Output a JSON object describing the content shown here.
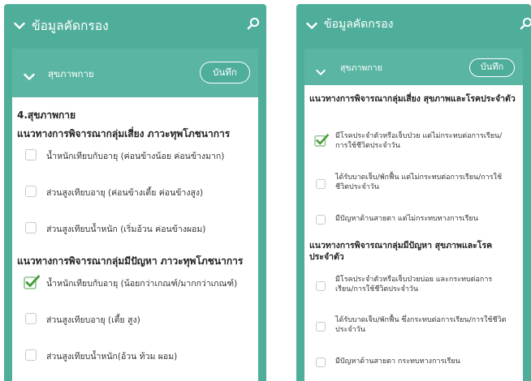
{
  "colors": {
    "accent": "#4fae9a",
    "header": "#5ab5a2",
    "check": "#4a9e3c"
  },
  "left": {
    "title": "ข้อมูลคัดกรอง",
    "card_label": "สุขภาพกาย",
    "save_label": "บันทึก",
    "heading": "4.สุขภาพกาย",
    "section1": "แนวทางการพิจารณากลุ่มเสี่ยง ภาวะทุพโภชนาการ",
    "items1": [
      {
        "label": "น้ำหนักเทียบกับอายุ (ค่อนข้างน้อย ค่อนข้างมาก)",
        "checked": false
      },
      {
        "label": "ส่วนสูงเทียบอายุ (ค่อนข้างเตี้ย ค่อนข้างสูง)",
        "checked": false
      },
      {
        "label": "ส่วนสูงเทียบน้ำหนัก (เริ่มอ้วน ค่อนข้างผอม)",
        "checked": false
      }
    ],
    "section2": "แนวทางการพิจารณากลุ่มมีปัญหา ภาวะทุพโภชนาการ",
    "items2": [
      {
        "label": "น้ำหนักเทียบกับอายุ (น้อยกว่าเกณฑ์/มากกว่าเกณฑ์)",
        "checked": true
      },
      {
        "label": "ส่วนสูงเทียบอายุ (เตี้ย สูง)",
        "checked": false
      },
      {
        "label": "ส่วนสูงเทียบน้ำหนัก(อ้วน ท้วม ผอม)",
        "checked": false
      }
    ]
  },
  "right": {
    "title": "ข้อมูลคัดกรอง",
    "card_label": "สุขภาพกาย",
    "save_label": "บันทึก",
    "section1": "แนวทางการพิจารณากลุ่มเสี่ยง สุขภาพและโรคประจำตัว",
    "items1": [
      {
        "label": "มีโรคประจำตัวหรือเจ็บป่วย แต่ไม่กระทบต่อการเรียน/การใช้ชีวิตประจำวัน",
        "checked": true
      },
      {
        "label": "ได้รับบาดเจ็บ/พักฟื้น แต่ไม่กระทบต่อการเรียน/การใช้ชีวิตประจำวัน",
        "checked": false
      },
      {
        "label": "มีปัญหาด้านสายตา แต่ไม่กระทบทางการเรียน",
        "checked": false
      }
    ],
    "section2": "แนวทางการพิจารณากลุ่มมีปัญหา สุขภาพและโรคประจำตัว",
    "items2": [
      {
        "label": "มีโรคประจำตัวหรือเจ็บป่วยบ่อย และกระทบต่อการเรียน/การใช้ชีวิตประจำวัน",
        "checked": false
      },
      {
        "label": "ได้รับบาดเจ็บ/พักฟื้น ซึ่งกระทบต่อการเรียน/การใช้ชีวิตประจำวัน",
        "checked": false
      },
      {
        "label": "มีปัญหาด้านสายตา กระทบทางการเรียน",
        "checked": false
      }
    ]
  }
}
